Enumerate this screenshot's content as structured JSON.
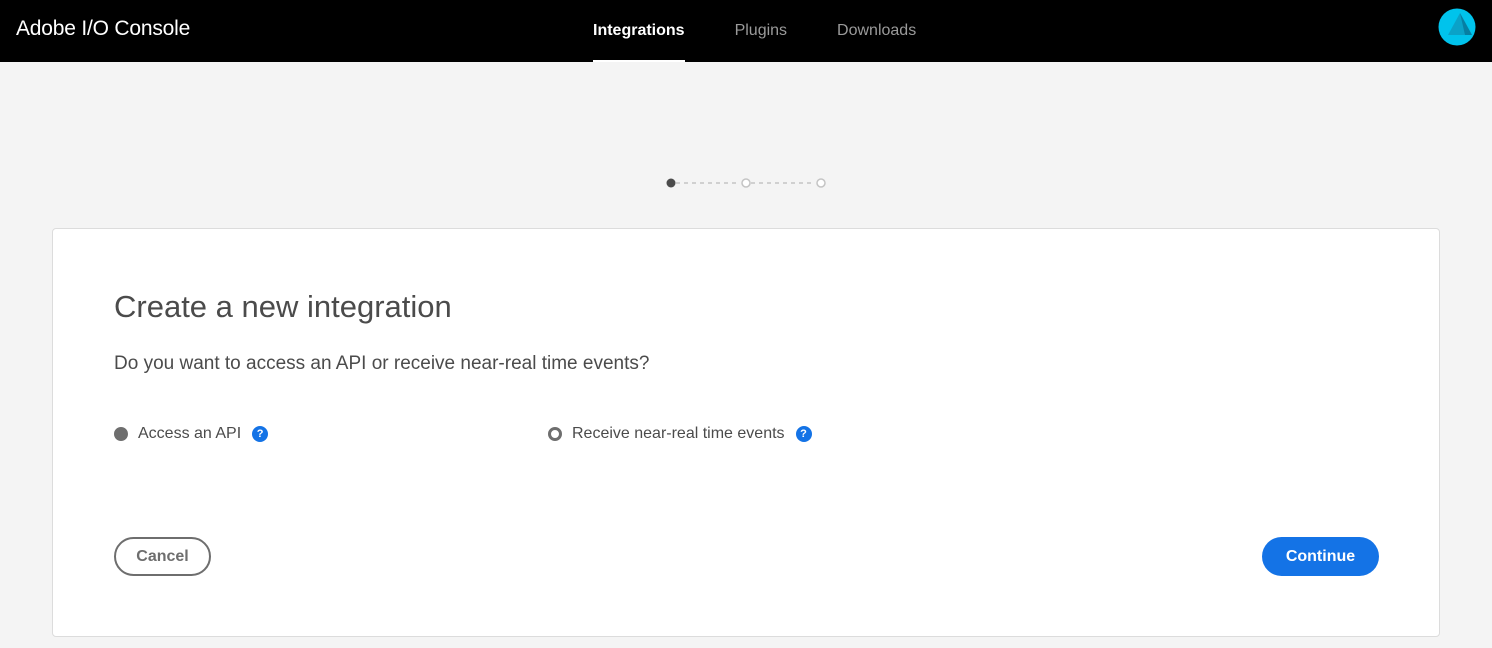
{
  "header": {
    "brand": "Adobe I/O Console",
    "tabs": [
      {
        "label": "Integrations",
        "active": true
      },
      {
        "label": "Plugins",
        "active": false
      },
      {
        "label": "Downloads",
        "active": false
      }
    ],
    "avatar_icon": "user-avatar-icon",
    "avatar_color": "#00c3ec"
  },
  "wizard": {
    "total_steps": 3,
    "current_step": 1
  },
  "card": {
    "title": "Create a new integration",
    "question": "Do you want to access an API or receive near-real time events?",
    "options": [
      {
        "label": "Access an API",
        "selected": true,
        "help_icon": "question-circle-icon"
      },
      {
        "label": "Receive near-real time events",
        "selected": false,
        "help_icon": "question-circle-icon"
      }
    ],
    "help_glyph": "?",
    "cancel_label": "Cancel",
    "continue_label": "Continue"
  },
  "colors": {
    "accent": "#1473e6",
    "topbar": "#000000",
    "background": "#f4f4f4",
    "text": "#4b4b4b"
  }
}
